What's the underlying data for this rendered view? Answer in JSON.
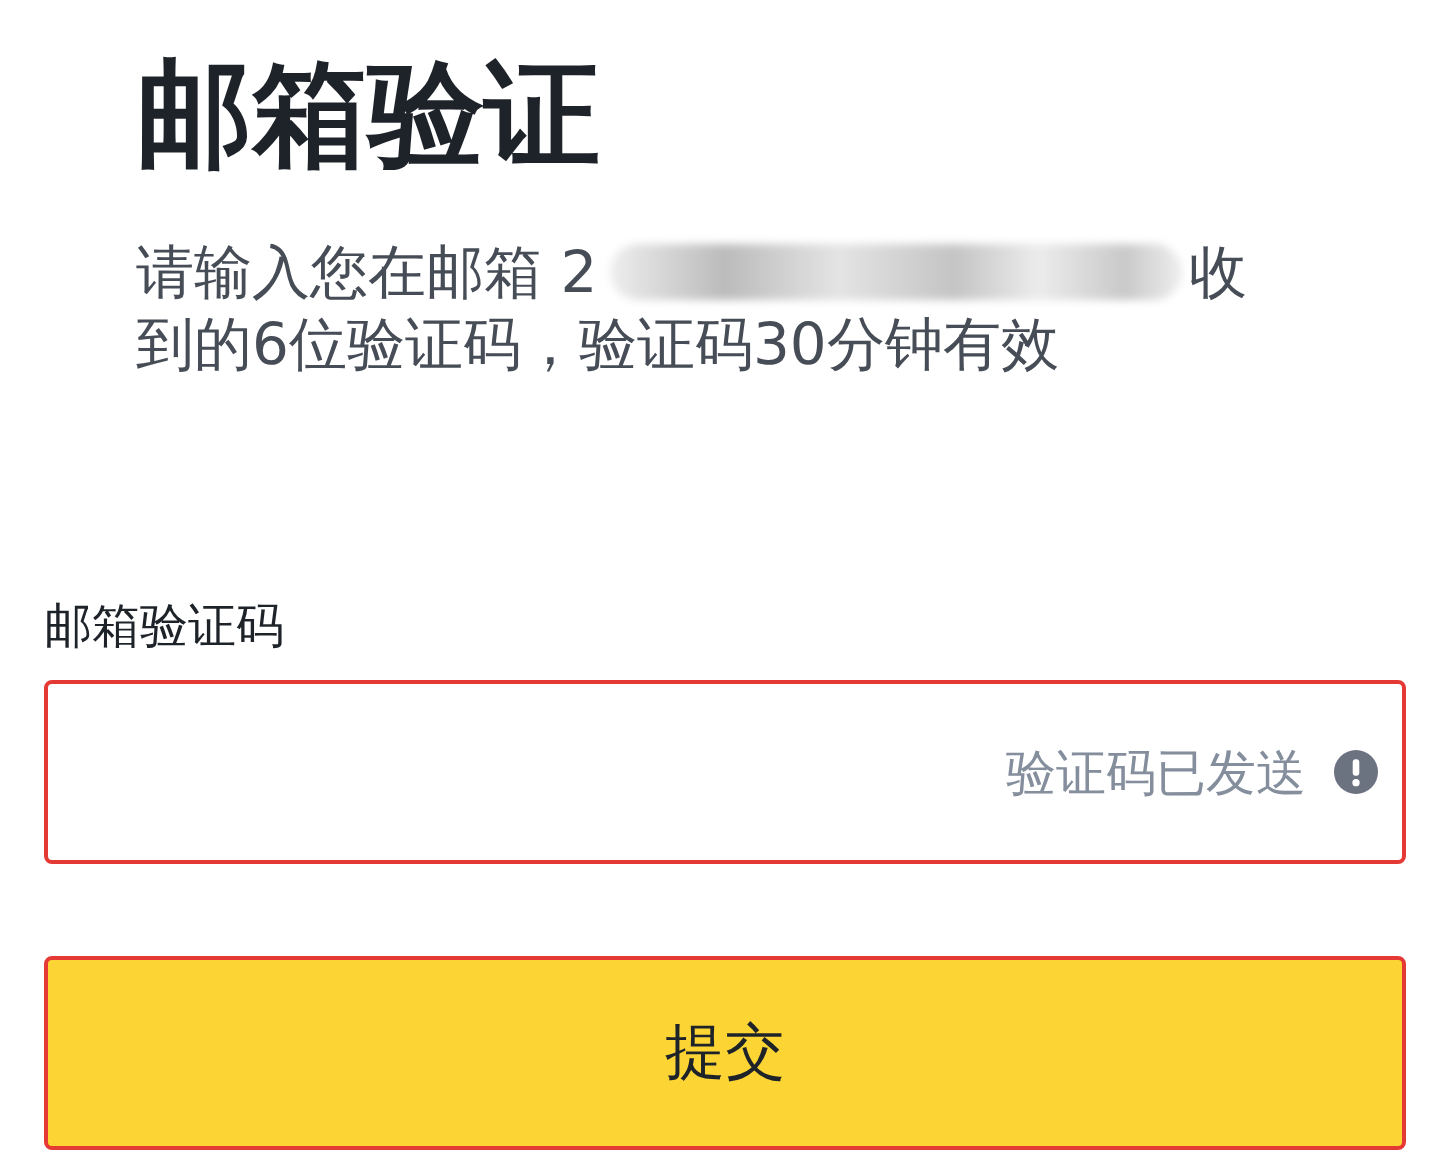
{
  "title": "邮箱验证",
  "prompt": {
    "lead": "请输入您在邮箱 2",
    "redacted": true,
    "tail": "收",
    "line_2": "到的6位验证码，验证码30分钟有效"
  },
  "code_field": {
    "label": "邮箱验证码",
    "error": true,
    "message": "验证码已发送"
  },
  "submit_button": {
    "label": "提交",
    "outlined": true
  }
}
